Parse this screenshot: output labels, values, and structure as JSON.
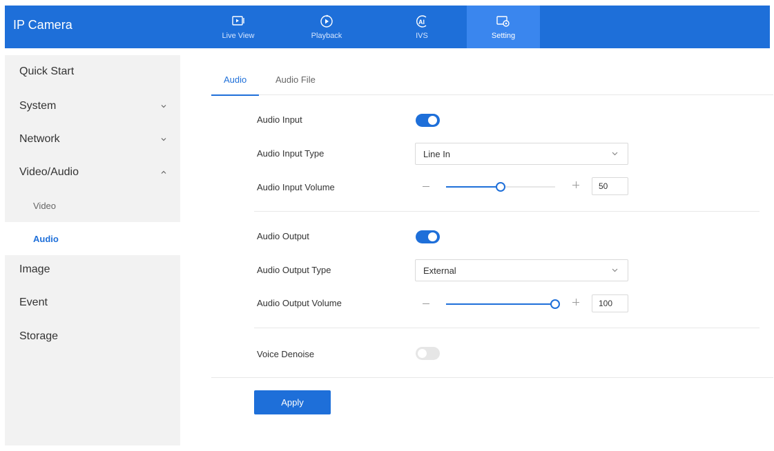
{
  "header": {
    "title": "IP Camera",
    "nav": [
      {
        "label": "Live View",
        "icon": "live-view-icon"
      },
      {
        "label": "Playback",
        "icon": "playback-icon"
      },
      {
        "label": "IVS",
        "icon": "ivs-ai-icon"
      },
      {
        "label": "Setting",
        "icon": "setting-icon",
        "active": true
      }
    ]
  },
  "sidebar": {
    "items": [
      {
        "label": "Quick Start"
      },
      {
        "label": "System",
        "chevron": "down"
      },
      {
        "label": "Network",
        "chevron": "down"
      },
      {
        "label": "Video/Audio",
        "chevron": "up"
      },
      {
        "label": "Image"
      },
      {
        "label": "Event"
      },
      {
        "label": "Storage"
      }
    ],
    "subitems": [
      {
        "label": "Video"
      },
      {
        "label": "Audio",
        "active": true
      }
    ]
  },
  "tabs": [
    {
      "label": "Audio",
      "active": true
    },
    {
      "label": "Audio File"
    }
  ],
  "form": {
    "audio_input": {
      "label": "Audio Input",
      "enabled": true
    },
    "audio_input_type": {
      "label": "Audio Input Type",
      "value": "Line In"
    },
    "audio_input_volume": {
      "label": "Audio Input Volume",
      "value": "50",
      "level": 50
    },
    "audio_output": {
      "label": "Audio Output",
      "enabled": true
    },
    "audio_output_type": {
      "label": "Audio Output Type",
      "value": "External"
    },
    "audio_output_volume": {
      "label": "Audio Output Volume",
      "value": "100",
      "level": 100
    },
    "voice_denoise": {
      "label": "Voice Denoise",
      "enabled": false
    }
  },
  "actions": {
    "apply_label": "Apply"
  },
  "colors": {
    "accent": "#1e6fd9",
    "header": "#1e6fd9",
    "sidebar": "#f2f2f2"
  }
}
